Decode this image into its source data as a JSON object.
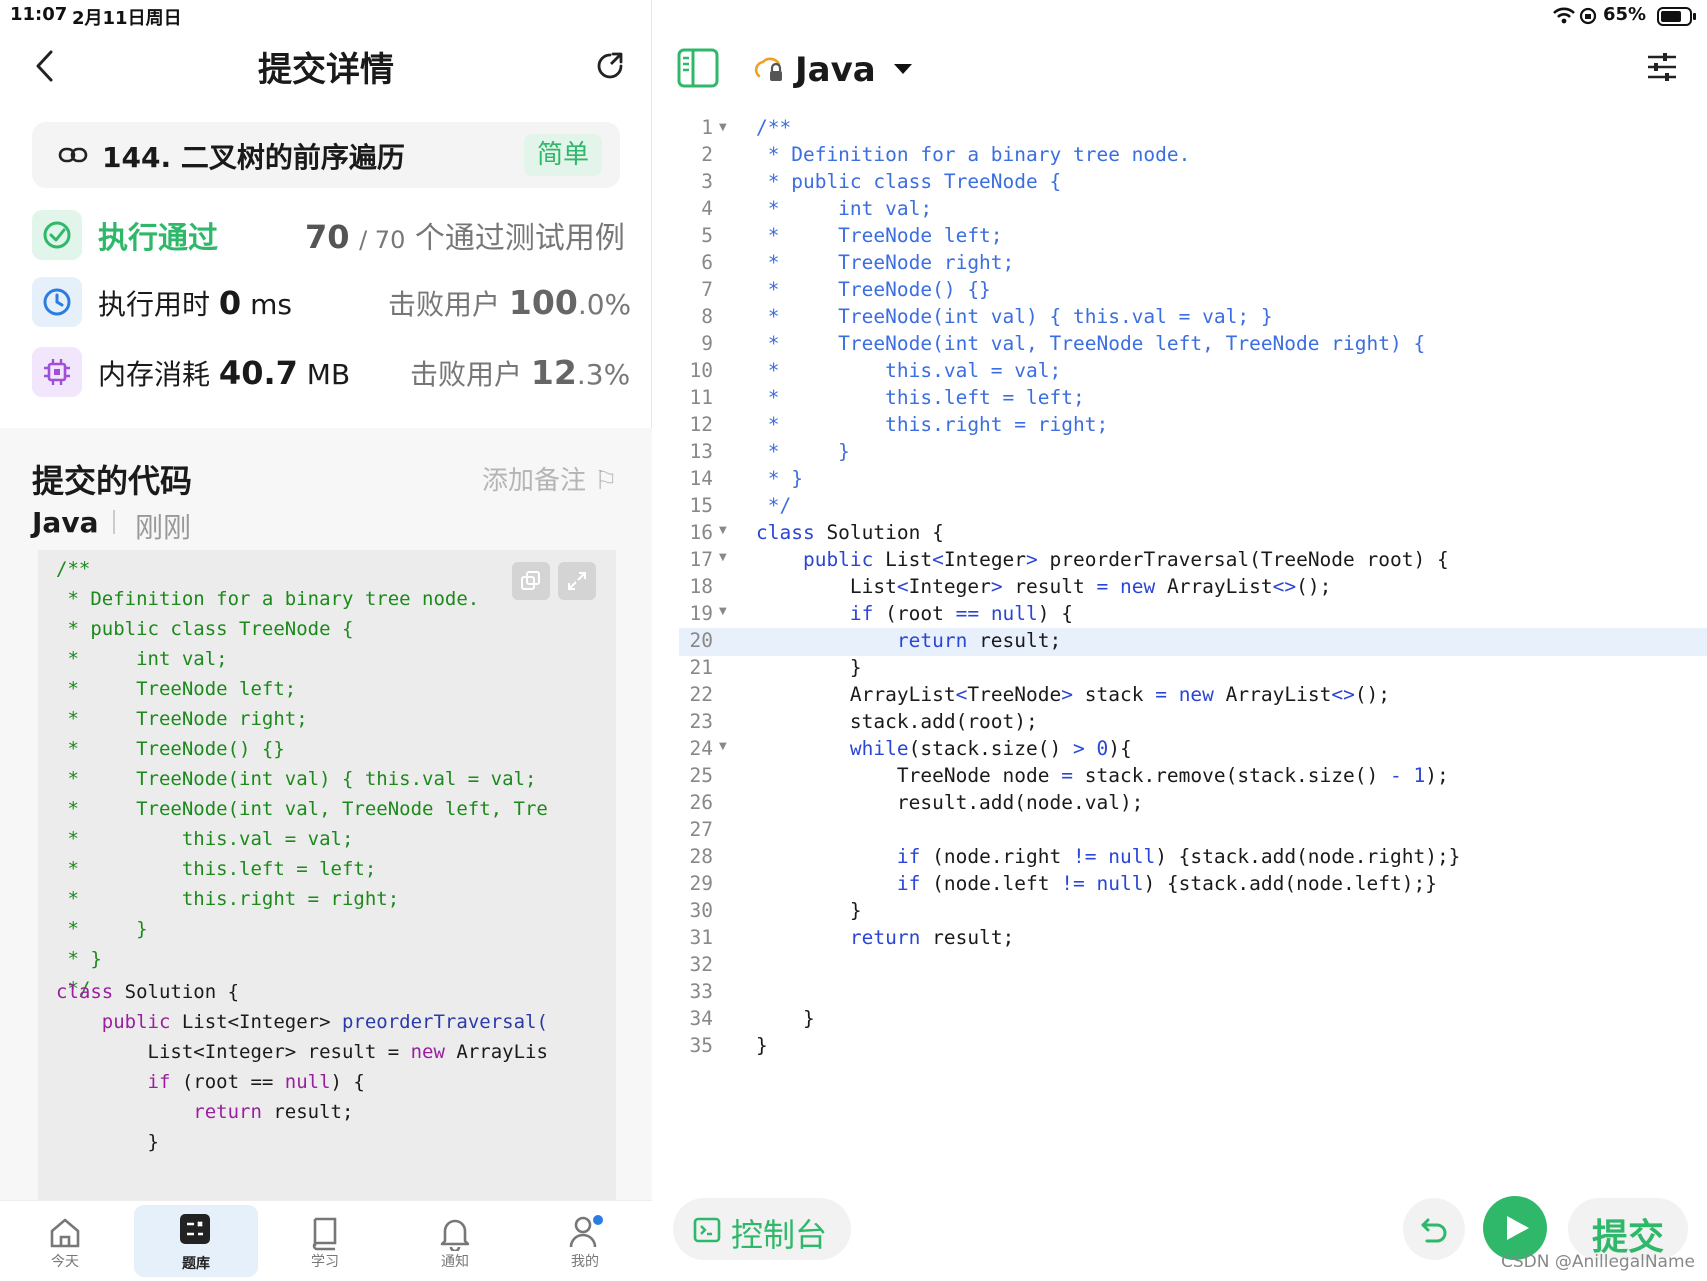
{
  "status_bar": {
    "time": "11:07",
    "date": "2月11日周日",
    "battery": "65%"
  },
  "left": {
    "header": {
      "title": "提交详情"
    },
    "problem": {
      "title": "144. 二叉树的前序遍历",
      "difficulty": "简单"
    },
    "result": {
      "status": "执行通过",
      "passed": "70",
      "total": "/ 70",
      "passed_label": "个通过测试用例"
    },
    "runtime": {
      "label": "执行用时",
      "value": "0",
      "unit": "ms",
      "beat_label": "击败用户",
      "beat_value": "100",
      "beat_unit": ".0%"
    },
    "memory": {
      "label": "内存消耗",
      "value": "40.7",
      "unit": "MB",
      "beat_label": "击败用户",
      "beat_value": "12",
      "beat_unit": ".3%"
    },
    "code_section": {
      "title": "提交的代码",
      "note": "添加备注",
      "language": "Java",
      "time": "刚刚"
    },
    "code_lines": [
      "/**",
      " * Definition for a binary tree node.",
      " * public class TreeNode {",
      " *     int val;",
      " *     TreeNode left;",
      " *     TreeNode right;",
      " *     TreeNode() {}",
      " *     TreeNode(int val) { this.val = val;",
      " *     TreeNode(int val, TreeNode left, Tre",
      " *         this.val = val;",
      " *         this.left = left;",
      " *         this.right = right;",
      " *     }",
      " * }",
      " */"
    ],
    "code_tail": {
      "l16a": "class",
      "l16b": " Solution {",
      "l17a": "    public",
      "l17b": " List<Integer> ",
      "l17c": "preorderTraversal(",
      "l18a": "        List<Integer> result = ",
      "l18b": "new",
      "l18c": " ArrayLis",
      "l19a": "        if",
      "l19b": " (root == ",
      "l19c": "null",
      "l19d": ") {",
      "l20a": "            return",
      "l20b": " result;",
      "l21": "        }"
    },
    "tabs": [
      "今天",
      "题库",
      "学习",
      "通知",
      "我的"
    ]
  },
  "right": {
    "language": "Java",
    "line_numbers": [
      "1",
      "2",
      "3",
      "4",
      "5",
      "6",
      "7",
      "8",
      "9",
      "10",
      "11",
      "12",
      "13",
      "14",
      "15",
      "16",
      "17",
      "18",
      "19",
      "20",
      "21",
      "22",
      "23",
      "24",
      "25",
      "26",
      "27",
      "28",
      "29",
      "30",
      "31",
      "32",
      "33",
      "34",
      "35"
    ],
    "comment_lines": [
      "/**",
      " * Definition for a binary tree node.",
      " * public class TreeNode {",
      " *     int val;",
      " *     TreeNode left;",
      " *     TreeNode right;",
      " *     TreeNode() {}",
      " *     TreeNode(int val) { this.val = val; }",
      " *     TreeNode(int val, TreeNode left, TreeNode right) {",
      " *         this.val = val;",
      " *         this.left = left;",
      " *         this.right = right;",
      " *     }",
      " * }",
      " */"
    ],
    "code": {
      "l16a": "class",
      "l16b": " Solution {",
      "l17a": "    public",
      "l17b": " List",
      "l17c": "<",
      "l17d": "Integer",
      "l17e": ">",
      "l17f": " preorderTraversal(TreeNode root) {",
      "l18a": "        List",
      "l18b": "<",
      "l18c": "Integer",
      "l18d": ">",
      "l18e": " result ",
      "l18f": "=",
      "l18g": " new",
      "l18h": " ArrayList",
      "l18i": "<>",
      "l18j": "();",
      "l19a": "        if",
      "l19b": " (root ",
      "l19c": "==",
      "l19d": " null",
      "l19e": ") {",
      "l20a": "            return",
      "l20b": " result;",
      "l21": "        }",
      "l22a": "        ArrayList",
      "l22b": "<",
      "l22c": "TreeNode",
      "l22d": ">",
      "l22e": " stack ",
      "l22f": "=",
      "l22g": " new",
      "l22h": " ArrayList",
      "l22i": "<>",
      "l22j": "();",
      "l23": "        stack.add(root);",
      "l24a": "        while",
      "l24b": "(stack.size() ",
      "l24c": ">",
      "l24d": " 0",
      "l24e": "){",
      "l25a": "            TreeNode node ",
      "l25b": "=",
      "l25c": " stack.remove(stack.size() ",
      "l25d": "-",
      "l25e": " 1",
      "l25f": ");",
      "l26": "            result.add(node.val);",
      "l28a": "            if",
      "l28b": " (node.right ",
      "l28c": "!=",
      "l28d": " null",
      "l28e": ") {stack.add(node.right);}",
      "l29a": "            if",
      "l29b": " (node.left ",
      "l29c": "!=",
      "l29d": " null",
      "l29e": ") {stack.add(node.left);}",
      "l30": "        }",
      "l31a": "        return",
      "l31b": " result;",
      "l34": "    }",
      "l35": "}"
    },
    "bottom": {
      "console": "控制台",
      "submit": "提交"
    }
  },
  "watermark": "CSDN @AnillegalName"
}
